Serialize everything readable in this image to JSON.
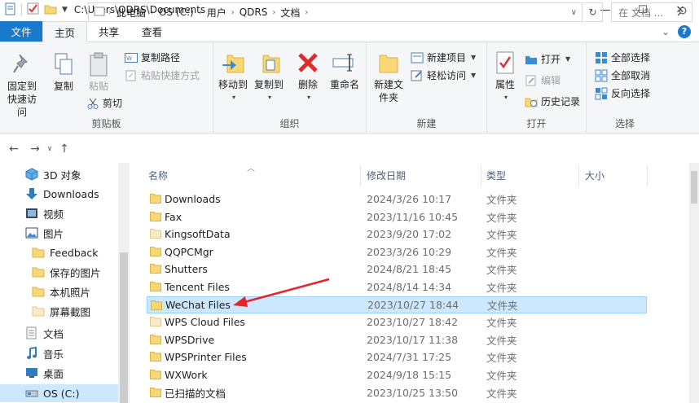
{
  "titlebar": {
    "path": "C:\\Users\\QDRS\\Documents",
    "qat_icons": [
      "properties-icon",
      "checkmark-icon",
      "folder-icon",
      "dropdown-icon"
    ],
    "controls": {
      "minimize": "—",
      "maximize": "☐",
      "close": "✕"
    }
  },
  "ribbon_tabs": {
    "file": "文件",
    "home": "主页",
    "share": "共享",
    "view": "查看",
    "expand": "⌄"
  },
  "ribbon": {
    "clipboard": {
      "label": "剪贴板",
      "pin": "固定到快速访问",
      "copy": "复制",
      "paste": "粘贴",
      "copy_path": "复制路径",
      "paste_shortcut": "粘贴快捷方式",
      "cut": "剪切"
    },
    "organize": {
      "label": "组织",
      "move_to": "移动到",
      "copy_to": "复制到",
      "delete": "删除",
      "rename": "重命名"
    },
    "new": {
      "label": "新建",
      "new_folder": "新建文件夹",
      "new_item": "新建项目",
      "easy_access": "轻松访问"
    },
    "open": {
      "label": "打开",
      "properties": "属性",
      "open": "打开",
      "edit": "编辑",
      "history": "历史记录"
    },
    "select": {
      "label": "选择",
      "select_all": "全部选择",
      "select_none": "全部取消",
      "invert": "反向选择"
    }
  },
  "address": {
    "crumbs": [
      "此电脑",
      "OS (C:)",
      "用户",
      "QDRS",
      "文档"
    ],
    "search_placeholder": "在 文档 ..."
  },
  "nav_pane": {
    "items": [
      {
        "label": "3D 对象",
        "icon": "3d-objects-icon"
      },
      {
        "label": "Downloads",
        "icon": "download-icon"
      },
      {
        "label": "视频",
        "icon": "video-icon"
      },
      {
        "label": "图片",
        "icon": "pictures-icon"
      },
      {
        "label": "Feedback",
        "icon": "folder-icon"
      },
      {
        "label": "保存的图片",
        "icon": "folder-icon"
      },
      {
        "label": "本机照片",
        "icon": "folder-icon"
      },
      {
        "label": "屏幕截图",
        "icon": "folder-icon"
      },
      {
        "label": "文档",
        "icon": "documents-icon"
      },
      {
        "label": "音乐",
        "icon": "music-icon"
      },
      {
        "label": "桌面",
        "icon": "desktop-icon"
      },
      {
        "label": "OS (C:)",
        "icon": "drive-icon"
      }
    ]
  },
  "file_list": {
    "columns": {
      "name": "名称",
      "date": "修改日期",
      "type": "类型",
      "size": "大小"
    },
    "rows": [
      {
        "name": "Downloads",
        "date": "2024/3/26 10:17",
        "type": "文件夹"
      },
      {
        "name": "Fax",
        "date": "2023/11/16 10:45",
        "type": "文件夹"
      },
      {
        "name": "KingsoftData",
        "date": "2023/9/20 17:02",
        "type": "文件夹"
      },
      {
        "name": "QQPCMgr",
        "date": "2023/3/26 10:29",
        "type": "文件夹"
      },
      {
        "name": "Shutters",
        "date": "2024/8/21 18:45",
        "type": "文件夹"
      },
      {
        "name": "Tencent Files",
        "date": "2024/8/14 14:34",
        "type": "文件夹"
      },
      {
        "name": "WeChat Files",
        "date": "2023/10/27 18:44",
        "type": "文件夹"
      },
      {
        "name": "WPS Cloud Files",
        "date": "2023/10/27 18:42",
        "type": "文件夹"
      },
      {
        "name": "WPSDrive",
        "date": "2023/10/17 11:38",
        "type": "文件夹"
      },
      {
        "name": "WPSPrinter Files",
        "date": "2024/7/31 17:25",
        "type": "文件夹"
      },
      {
        "name": "WXWork",
        "date": "2024/9/18 15:15",
        "type": "文件夹"
      },
      {
        "name": "已扫描的文档",
        "date": "2023/10/25 13:50",
        "type": "文件夹"
      }
    ],
    "selected_row": "WeChat Files"
  },
  "colors": {
    "accent": "#1979ca",
    "selection": "#cce8ff",
    "annotation_arrow": "#e8232a",
    "folder": "#f8d775"
  }
}
